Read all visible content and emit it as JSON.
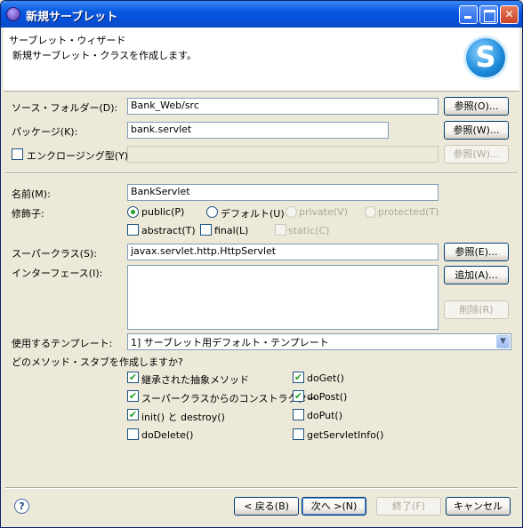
{
  "window": {
    "title": "新規サーブレット",
    "minimize": "",
    "maximize": "",
    "close": "✕"
  },
  "header": {
    "title": "サーブレット・ウィザード",
    "description": "新規サーブレット・クラスを作成します。",
    "logo_letter": "S"
  },
  "form": {
    "source_folder": {
      "label": "ソース・フォルダー(D):",
      "value": "Bank_Web/src",
      "button": "参照(O)..."
    },
    "package": {
      "label": "パッケージ(K):",
      "value": "bank.servlet",
      "button": "参照(W)..."
    },
    "enclosing": {
      "label": "エンクロージング型(Y):",
      "value": "",
      "checked": false,
      "button": "参照(W)..."
    },
    "name": {
      "label": "名前(M):",
      "value": "BankServlet"
    },
    "modifiers": {
      "label": "修飾子:",
      "public": {
        "label": "public(P)",
        "selected": true
      },
      "default": {
        "label": "デフォルト(U)",
        "selected": false
      },
      "private": {
        "label": "private(V)",
        "selected": false
      },
      "protected": {
        "label": "protected(T)",
        "selected": false
      },
      "abstract": {
        "label": "abstract(T)",
        "checked": false
      },
      "final": {
        "label": "final(L)",
        "checked": false
      },
      "static": {
        "label": "static(C)",
        "checked": false
      }
    },
    "superclass": {
      "label": "スーパークラス(S):",
      "value": "javax.servlet.http.HttpServlet",
      "button": "参照(E)..."
    },
    "interfaces": {
      "label": "インターフェース(I):",
      "add_button": "追加(A)...",
      "remove_button": "削除(R)"
    },
    "template": {
      "label": "使用するテンプレート:",
      "selected": "1] サーブレット用デフォルト・テンプレート"
    },
    "stubs": {
      "question": "どのメソッド・スタブを作成しますか?",
      "items": [
        {
          "label": "継承された抽象メソッド",
          "checked": true
        },
        {
          "label": "スーパークラスからのコンストラクター",
          "checked": true
        },
        {
          "label": "init() と destroy()",
          "checked": true
        },
        {
          "label": "doDelete()",
          "checked": false
        },
        {
          "label": "doGet()",
          "checked": true
        },
        {
          "label": "doPost()",
          "checked": true
        },
        {
          "label": "doPut()",
          "checked": false
        },
        {
          "label": "getServletInfo()",
          "checked": false
        }
      ]
    }
  },
  "footer": {
    "back": "< 戻る(B)",
    "next": "次へ >(N)",
    "finish": "終了(F)",
    "cancel": "キャンセル"
  },
  "colors": {
    "titlebar": "#0550d8",
    "check_mark": "#21a121",
    "dialog_bg": "#ece9d8"
  }
}
